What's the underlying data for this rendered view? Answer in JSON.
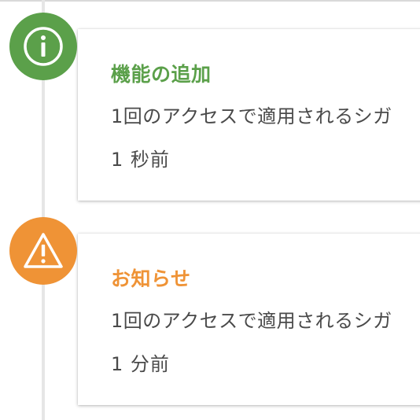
{
  "colors": {
    "info": "#5ba04a",
    "warning": "#ef9336",
    "text": "#4a4a4a",
    "timeline": "#e6e6e6"
  },
  "events": [
    {
      "icon": "info-icon",
      "title": "機能の追加",
      "message": "1回のアクセスで適用されるシガ",
      "time": "1 秒前"
    },
    {
      "icon": "warning-icon",
      "title": "お知らせ",
      "message": "1回のアクセスで適用されるシガ",
      "time": "1 分前"
    }
  ]
}
